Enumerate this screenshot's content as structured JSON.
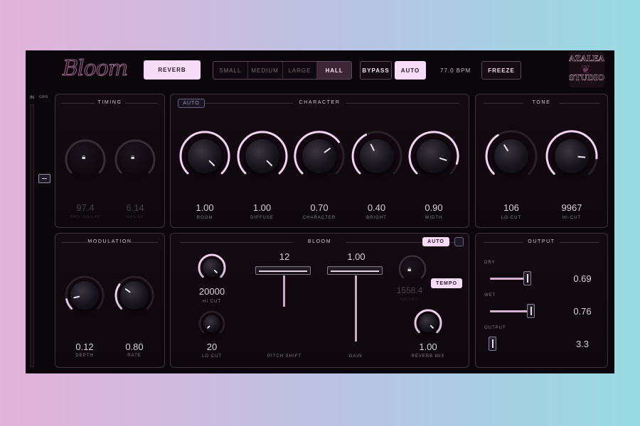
{
  "header": {
    "logo_text": "Bloom",
    "reverb_label": "REVERB",
    "sizes": [
      {
        "label": "SMALL",
        "active": false
      },
      {
        "label": "MEDIUM",
        "active": false
      },
      {
        "label": "LARGE",
        "active": false
      },
      {
        "label": "HALL",
        "active": true
      }
    ],
    "bypass_label": "BYPASS",
    "auto_label": "AUTO",
    "bpm": "77.0 BPM",
    "freeze_label": "FREEZE",
    "brand_line1": "AZALEA",
    "brand_line2": "STUDIOS"
  },
  "side": {
    "in_label": "IN",
    "gain_label": "GAIN"
  },
  "timing": {
    "title": "TIMING",
    "knobs": [
      {
        "value": "97.4",
        "label": "PRE-DELAY"
      },
      {
        "value": "6.14",
        "label": "DECAY"
      }
    ]
  },
  "character": {
    "title": "CHARACTER",
    "auto_label": "AUTO",
    "knobs": [
      {
        "value": "1.00",
        "label": "ROOM",
        "level": 1.0
      },
      {
        "value": "1.00",
        "label": "DIFFUSE",
        "level": 1.0
      },
      {
        "value": "0.70",
        "label": "CHARACTER",
        "level": 0.7
      },
      {
        "value": "0.40",
        "label": "BRIGHT",
        "level": 0.4
      },
      {
        "value": "0.90",
        "label": "WIDTH",
        "level": 0.9
      }
    ]
  },
  "tone": {
    "title": "TONE",
    "knobs": [
      {
        "value": "106",
        "label": "LO-CUT",
        "level": 0.38
      },
      {
        "value": "9967",
        "label": "HI-CUT",
        "level": 0.85
      }
    ]
  },
  "modulation": {
    "title": "MODULATION",
    "knobs": [
      {
        "value": "0.12",
        "label": "DEPTH",
        "level": 0.12
      },
      {
        "value": "0.80",
        "label": "RATE",
        "level": 0.3
      }
    ]
  },
  "bloom": {
    "title": "BLOOM",
    "auto_label": "AUTO",
    "hicut": {
      "value": "20000",
      "label": "HI CUT",
      "level": 1.0
    },
    "locut": {
      "value": "20",
      "label": "LO CUT",
      "level": 0.0
    },
    "pitch": {
      "value": "12",
      "label": "PITCH SHIFT",
      "level": 0.5
    },
    "gain": {
      "value": "1.00",
      "label": "GAIN",
      "level": 1.0
    },
    "delay": {
      "value": "1558.4",
      "label": "DELAY"
    },
    "tempo_label": "TEMPO",
    "mix": {
      "value": "1.00",
      "label": "REVERB MIX",
      "level": 1.0
    }
  },
  "output": {
    "title": "OUTPUT",
    "rows": [
      {
        "label": "DRY",
        "value": "0.69",
        "level": 0.69
      },
      {
        "label": "WET",
        "value": "0.76",
        "level": 0.76
      },
      {
        "label": "OUTPUT",
        "value": "3.3",
        "level": 0.05
      }
    ]
  },
  "colors": {
    "accent": "#f6dcf6",
    "arc": "#f4d2f2",
    "background": "#0b060b"
  }
}
